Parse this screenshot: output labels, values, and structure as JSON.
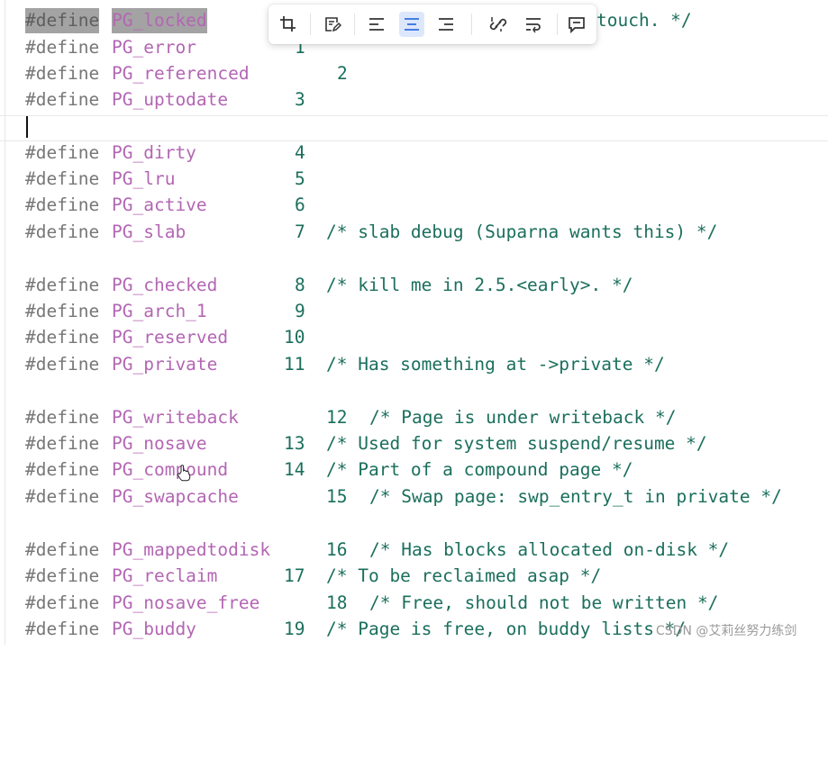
{
  "code": {
    "keyword": "#define",
    "lines": [
      {
        "name": "PG_locked",
        "value": "",
        "comment": "touch. */"
      },
      {
        "name": "PG_error",
        "value": "1",
        "comment": ""
      },
      {
        "name": "PG_referenced",
        "value": "2",
        "comment": ""
      },
      {
        "name": "PG_uptodate",
        "value": "3",
        "comment": ""
      },
      {
        "name": "PG_dirty",
        "value": "4",
        "comment": ""
      },
      {
        "name": "PG_lru",
        "value": "5",
        "comment": ""
      },
      {
        "name": "PG_active",
        "value": "6",
        "comment": ""
      },
      {
        "name": "PG_slab",
        "value": "7",
        "comment": "/* slab debug (Suparna wants this) */"
      },
      {
        "name": "PG_checked",
        "value": "8",
        "comment": "/* kill me in 2.5.<early>. */"
      },
      {
        "name": "PG_arch_1",
        "value": "9",
        "comment": ""
      },
      {
        "name": "PG_reserved",
        "value": "10",
        "comment": ""
      },
      {
        "name": "PG_private",
        "value": "11",
        "comment": "/* Has something at ->private */"
      },
      {
        "name": "PG_writeback",
        "value": "12",
        "comment": "/* Page is under writeback */"
      },
      {
        "name": "PG_nosave",
        "value": "13",
        "comment": "/* Used for system suspend/resume */"
      },
      {
        "name": "PG_compound",
        "value": "14",
        "comment": "/* Part of a compound page */"
      },
      {
        "name": "PG_swapcache",
        "value": "15",
        "comment": "/* Swap page: swp_entry_t in private */"
      },
      {
        "name": "PG_mappedtodisk",
        "value": "16",
        "comment": "/* Has blocks allocated on-disk */"
      },
      {
        "name": "PG_reclaim",
        "value": "17",
        "comment": "/* To be reclaimed asap */"
      },
      {
        "name": "PG_nosave_free",
        "value": "18",
        "comment": "/* Free, should not be written */"
      },
      {
        "name": "PG_buddy",
        "value": "19",
        "comment": "/* Page is free, on buddy lists */"
      }
    ]
  },
  "toolbar": {
    "buttons": [
      "crop-icon",
      "edit-note-icon",
      "align-left-icon",
      "align-center-icon",
      "align-right-icon",
      "link-icon",
      "text-wrap-icon",
      "comment-icon"
    ],
    "active": "align-center-icon"
  },
  "watermark": "CSDN @艾莉丝努力练剑",
  "colors": {
    "keyword": "#777777",
    "identifier": "#b366b3",
    "number": "#1b6f5c",
    "comment": "#1b6f5c",
    "selection": "#a3a3a3",
    "toolbar_active": "#dde7fb"
  }
}
